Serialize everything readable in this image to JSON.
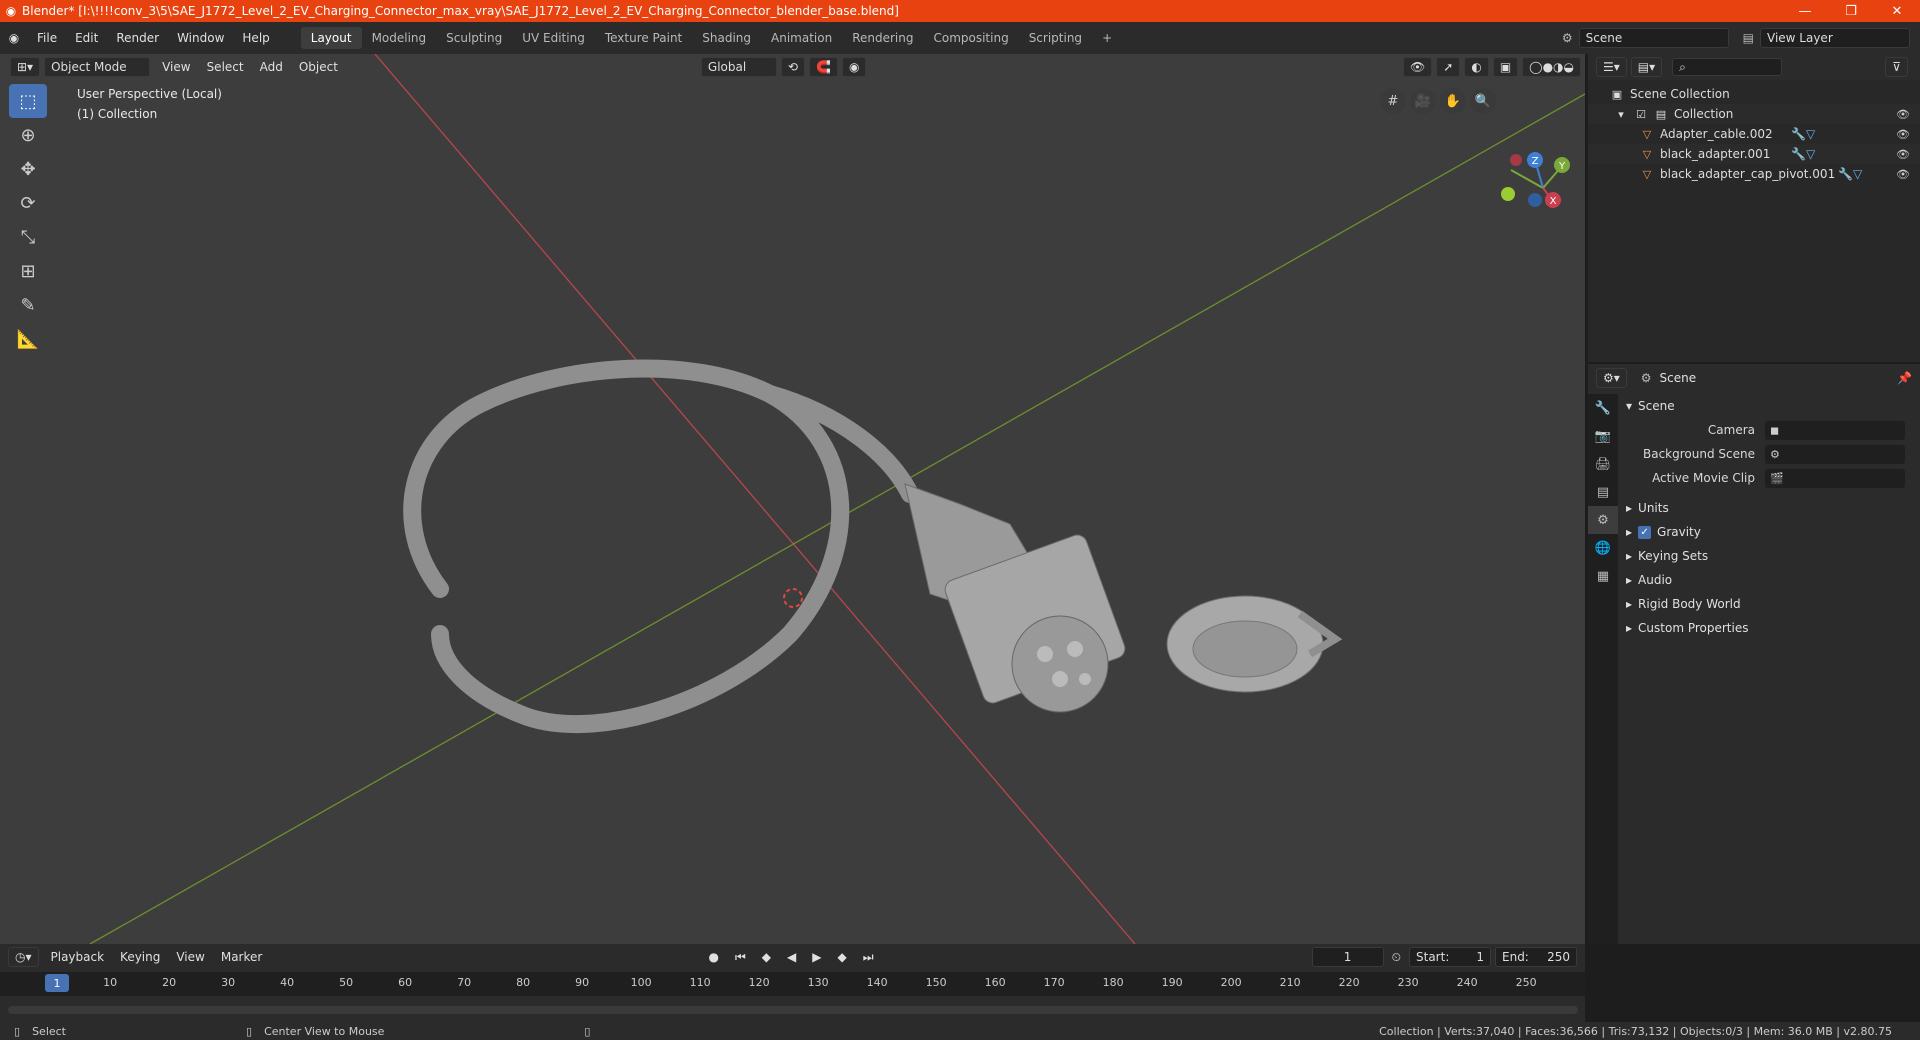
{
  "titlebar": {
    "title": "Blender* [I:\\!!!!conv_3\\5\\SAE_J1772_Level_2_EV_Charging_Connector_max_vray\\SAE_J1772_Level_2_EV_Charging_Connector_blender_base.blend]",
    "minimize": "—",
    "maximize": "❐",
    "close": "✕"
  },
  "menu": [
    "File",
    "Edit",
    "Render",
    "Window",
    "Help"
  ],
  "workspaces": [
    "Layout",
    "Modeling",
    "Sculpting",
    "UV Editing",
    "Texture Paint",
    "Shading",
    "Animation",
    "Rendering",
    "Compositing",
    "Scripting"
  ],
  "add_workspace": "+",
  "scene_field": "Scene",
  "view_layer_field": "View Layer",
  "viewport": {
    "mode": "Object Mode",
    "menus": [
      "View",
      "Select",
      "Add",
      "Object"
    ],
    "orientation": "Global",
    "info_line1": "User Perspective (Local)",
    "info_line2": "(1) Collection",
    "gizmo": {
      "x": "X",
      "y": "Y",
      "z": "Z"
    }
  },
  "outliner": {
    "root": "Scene Collection",
    "collection": "Collection",
    "items": [
      "Adapter_cable.002",
      "black_adapter.001",
      "black_adapter_cap_pivot.001"
    ]
  },
  "properties": {
    "context": "Scene",
    "section": "Scene",
    "fields": [
      {
        "label": "Camera",
        "value": ""
      },
      {
        "label": "Background Scene",
        "value": ""
      },
      {
        "label": "Active Movie Clip",
        "value": ""
      }
    ],
    "subsections": [
      "Units",
      "Gravity",
      "Keying Sets",
      "Audio",
      "Rigid Body World",
      "Custom Properties"
    ]
  },
  "timeline": {
    "menus": [
      "Playback",
      "Keying",
      "View",
      "Marker"
    ],
    "current_frame": "1",
    "start_label": "Start:",
    "start": "1",
    "end_label": "End:",
    "end": "250",
    "ticks": [
      "10",
      "20",
      "30",
      "40",
      "50",
      "60",
      "70",
      "80",
      "90",
      "100",
      "110",
      "120",
      "130",
      "140",
      "150",
      "160",
      "170",
      "180",
      "190",
      "200",
      "210",
      "220",
      "230",
      "240",
      "250"
    ]
  },
  "statusbar": {
    "left": "Select",
    "middle": "Center View to Mouse",
    "right": "Collection | Verts:37,040 | Faces:36,566 | Tris:73,132 | Objects:0/3 | Mem: 36.0 MB | v2.80.75"
  },
  "colors": {
    "accent": "#4772b3",
    "titlebar": "#e7420f",
    "x_axis": "#c8404f",
    "y_axis": "#7aa83a",
    "z_axis": "#3f7fd6"
  }
}
